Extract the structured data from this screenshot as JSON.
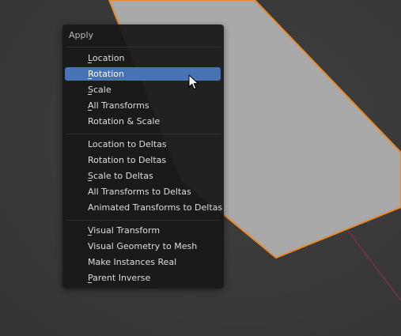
{
  "menu": {
    "title": "Apply",
    "groups": [
      {
        "items": [
          {
            "label": "Location",
            "active": false
          },
          {
            "label": "Rotation",
            "active": true
          },
          {
            "label": "Scale",
            "active": false
          },
          {
            "label": "All Transforms",
            "active": false
          },
          {
            "label": "Rotation & Scale",
            "active": false
          }
        ]
      },
      {
        "items": [
          {
            "label": "Location to Deltas",
            "active": false
          },
          {
            "label": "Rotation to Deltas",
            "active": false
          },
          {
            "label": "Scale to Deltas",
            "active": false
          },
          {
            "label": "All Transforms to Deltas",
            "active": false
          },
          {
            "label": "Animated Transforms to Deltas",
            "active": false
          }
        ]
      },
      {
        "items": [
          {
            "label": "Visual Transform",
            "active": false
          },
          {
            "label": "Visual Geometry to Mesh",
            "active": false
          },
          {
            "label": "Make Instances Real",
            "active": false
          },
          {
            "label": "Parent Inverse",
            "active": false
          }
        ]
      }
    ]
  },
  "colors": {
    "viewport_bg": "#3a3a3a",
    "menu_bg": "#181818",
    "highlight": "#4772b3",
    "selection_outline": "#e8892b",
    "mesh_face": "#a9a9a9",
    "axis_line": "#8a3040"
  }
}
